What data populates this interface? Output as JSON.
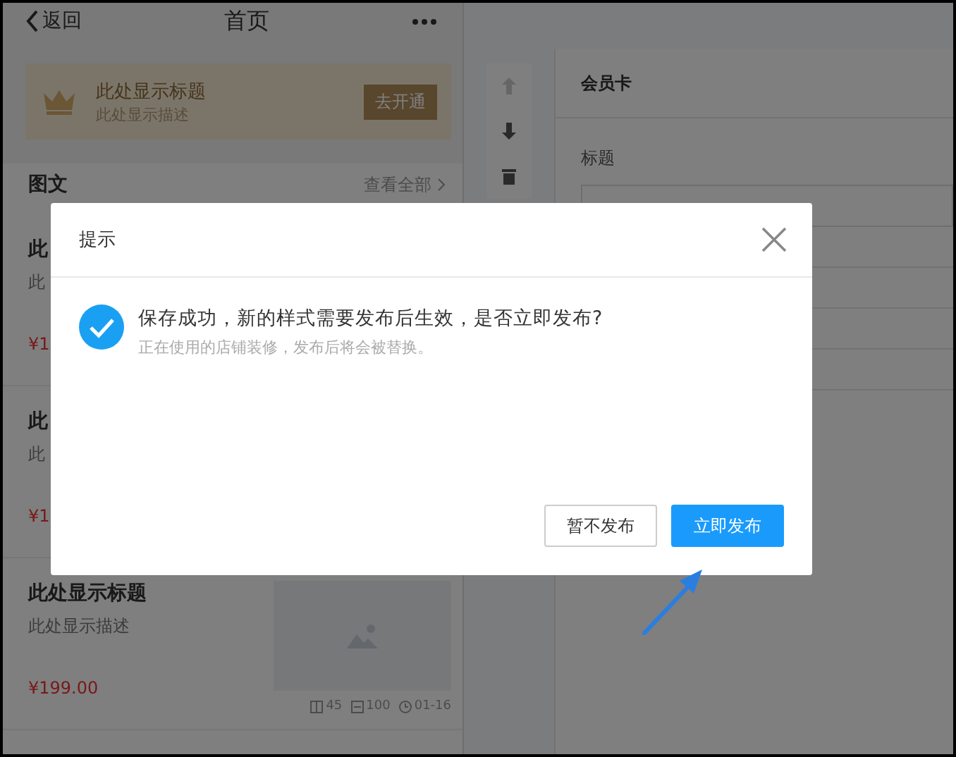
{
  "nav": {
    "back": "返回",
    "title": "首页"
  },
  "member_card": {
    "title": "此处显示标题",
    "description": "此处显示描述",
    "button": "去开通"
  },
  "section": {
    "title": "图文",
    "more": "查看全部"
  },
  "articles": [
    {
      "title": "此",
      "description": "此",
      "price": "¥1"
    },
    {
      "title": "此",
      "description": "此",
      "price": "¥1"
    },
    {
      "title": "此处显示标题",
      "description": "此处显示描述",
      "price": "¥199.00",
      "stats": [
        "45",
        "100",
        "01-16"
      ]
    }
  ],
  "toolbar": [
    {
      "kind": "up",
      "disabled": true
    },
    {
      "kind": "down",
      "disabled": false
    },
    {
      "kind": "delete",
      "disabled": false
    }
  ],
  "editor": {
    "title": "会员卡",
    "field_label": "标题"
  },
  "dialog": {
    "title": "提示",
    "message": "保存成功，新的样式需要发布后生效，是否立即发布?",
    "note": "正在使用的店铺装修，发布后将会被替换。",
    "buttons": [
      {
        "label": "暂不发布",
        "primary": false
      },
      {
        "label": "立即发布",
        "primary": true
      }
    ]
  }
}
